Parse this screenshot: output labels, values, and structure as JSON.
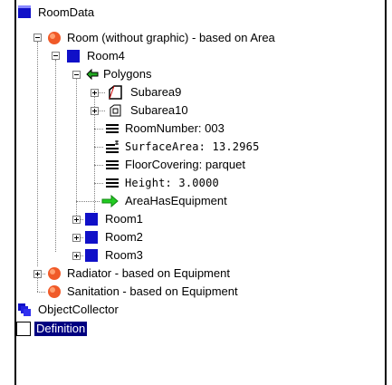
{
  "tree": {
    "root": "RoomData",
    "room_area": "Room (without graphic) - based on Area",
    "room4": "Room4",
    "polygons": "Polygons",
    "subarea9": "Subarea9",
    "subarea10": "Subarea10",
    "room_number": "RoomNumber: 003",
    "surface_area": "SurfaceArea: 13.2965",
    "floor_covering": "FloorCovering: parquet",
    "height": "Height: 3.0000",
    "area_has_equipment": "AreaHasEquipment",
    "room1": "Room1",
    "room2": "Room2",
    "room3": "Room3",
    "radiator": "Radiator - based on Equipment",
    "sanitation": "Sanitation - based on Equipment",
    "object_collector": "ObjectCollector",
    "definition": "Definition"
  },
  "colors": {
    "selection": "#000080",
    "class_blue": "#1010c8",
    "sphere_orange": "#f05a28",
    "arrow_green": "#22aa22"
  }
}
